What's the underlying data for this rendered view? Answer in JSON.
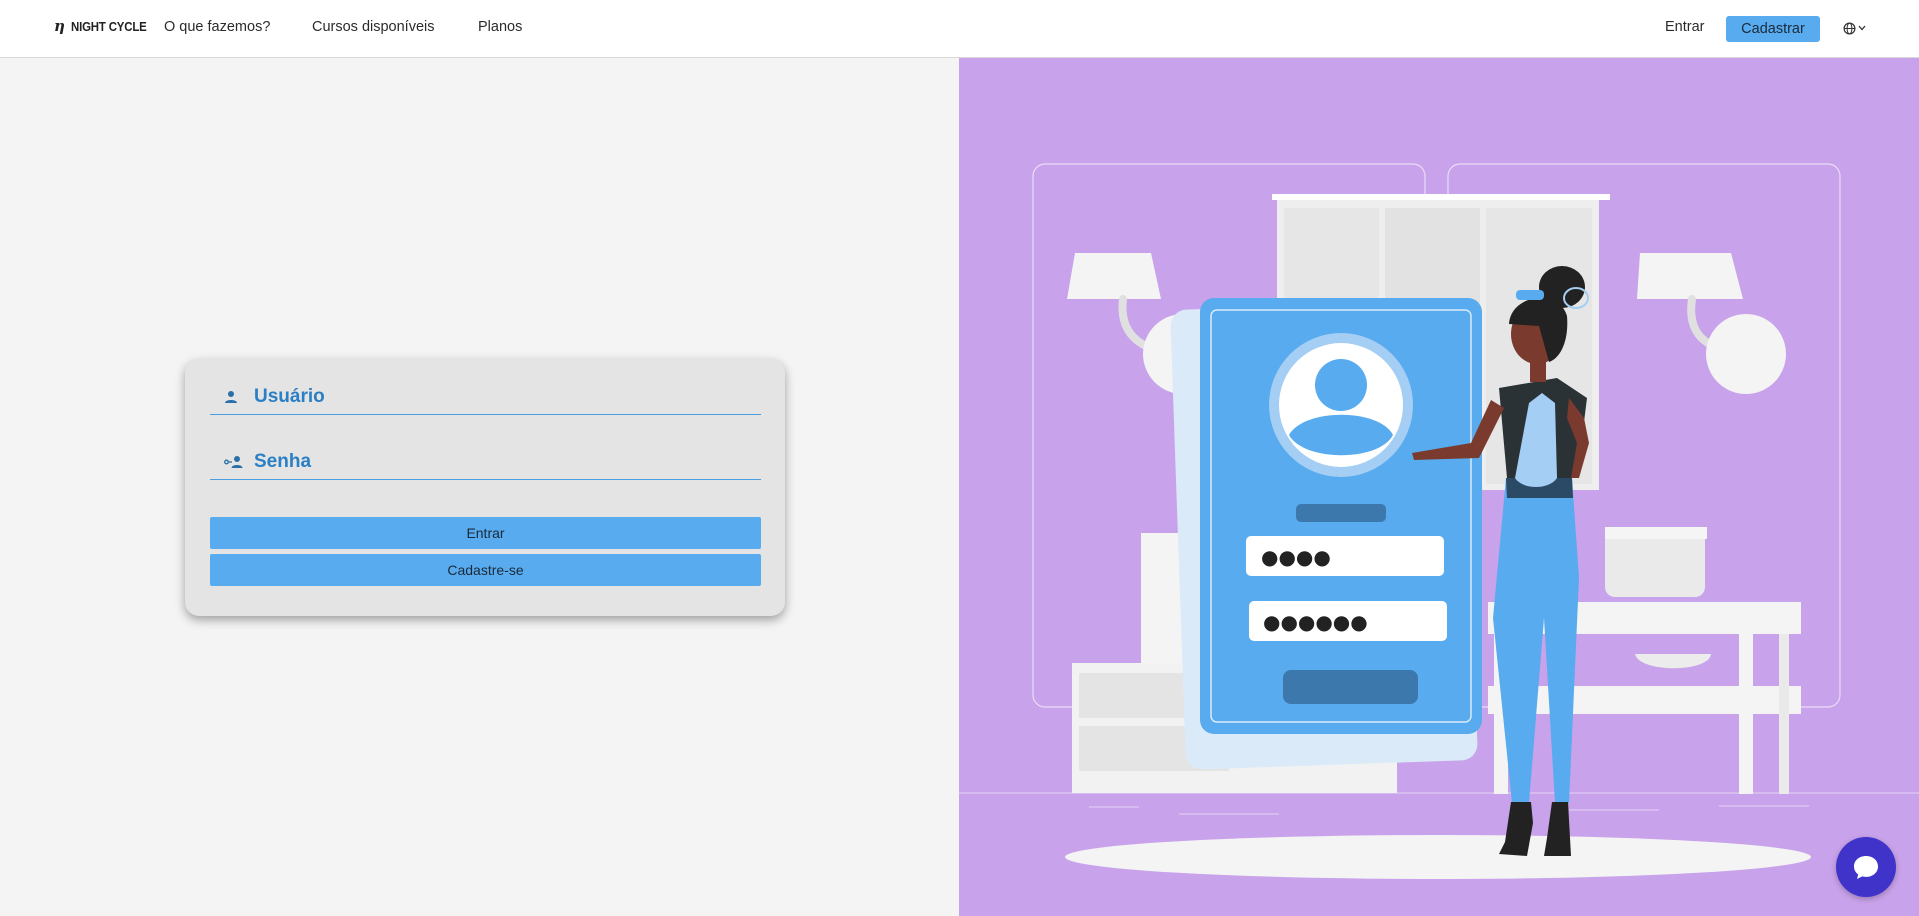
{
  "header": {
    "logo_mark": "η",
    "logo_text": "NIGHT CYCLE",
    "nav": [
      {
        "label": "O que fazemos?"
      },
      {
        "label": "Cursos disponíveis"
      },
      {
        "label": "Planos"
      }
    ],
    "login_label": "Entrar",
    "signup_label": "Cadastrar",
    "language_icon": "globe-icon"
  },
  "login_form": {
    "user_label": "Usuário",
    "user_icon": "person-icon",
    "password_label": "Senha",
    "password_icon": "key-person-icon",
    "submit_label": "Entrar",
    "register_label": "Cadastre-se"
  },
  "illustration": {
    "pin_masked": "●●●●",
    "password_masked": "●●●●●●"
  },
  "colors": {
    "accent": "#58abee",
    "label_blue": "#2b7fc4",
    "illustration_bg": "#c8a2ea",
    "chat_bg": "#4033c9"
  },
  "chat": {
    "icon": "chat-bubble-icon"
  }
}
